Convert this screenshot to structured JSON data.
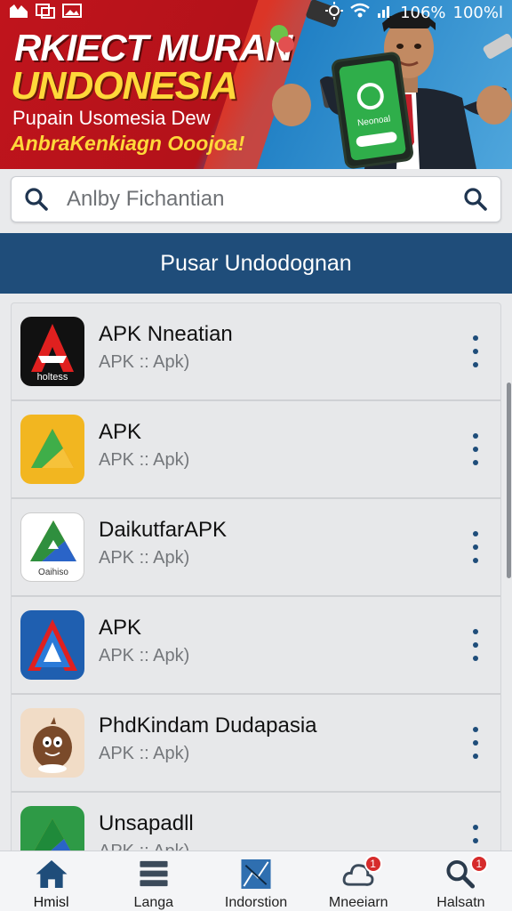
{
  "status_bar": {
    "battery_signal": "106%",
    "battery": "100%l"
  },
  "banner": {
    "title_line1": "RKIECT MURAN",
    "title_line2": "UNDONESIA",
    "subtitle_line1": "Pupain Usomesia Dew",
    "subtitle_line2": "AnbraKenkiagn Ooojoa!",
    "phone_text": "Neonoal"
  },
  "search": {
    "placeholder": "Anlby Fichantian"
  },
  "section": {
    "title": "Pusar Undodognan"
  },
  "apps": [
    {
      "name": "APK Nneatian",
      "sub": "APK :: Apk)",
      "icon": "red-a-logo-icon",
      "icon_caption": "holtess"
    },
    {
      "name": "APK",
      "sub": "APK :: Apk)",
      "icon": "yellow-triangle-icon"
    },
    {
      "name": "DaikutfarAPK",
      "sub": "APK :: Apk)",
      "icon": "drive-triangle-icon",
      "icon_caption": "Oaihiso"
    },
    {
      "name": "APK",
      "sub": "APK :: Apk)",
      "icon": "blue-a-logo-icon"
    },
    {
      "name": "PhdKindam Dudapasia",
      "sub": "APK :: Apk)",
      "icon": "mascot-icon"
    },
    {
      "name": "Unsapadll",
      "sub": "APK :: Apk)",
      "icon": "green-drive-icon"
    }
  ],
  "bottom_nav": {
    "items": [
      {
        "label": "Hmisl",
        "icon": "home-icon"
      },
      {
        "label": "Langa",
        "icon": "list-icon"
      },
      {
        "label": "Indorstion",
        "icon": "chart-icon"
      },
      {
        "label": "Mneeiarn",
        "icon": "cloud-icon",
        "badge": "1"
      },
      {
        "label": "Halsatn",
        "icon": "search-icon",
        "badge": "1"
      }
    ]
  },
  "colors": {
    "header_blue": "#1f4d7a",
    "banner_red": "#c0141c",
    "banner_yellow": "#ffd83a",
    "badge_red": "#d62b2b"
  }
}
